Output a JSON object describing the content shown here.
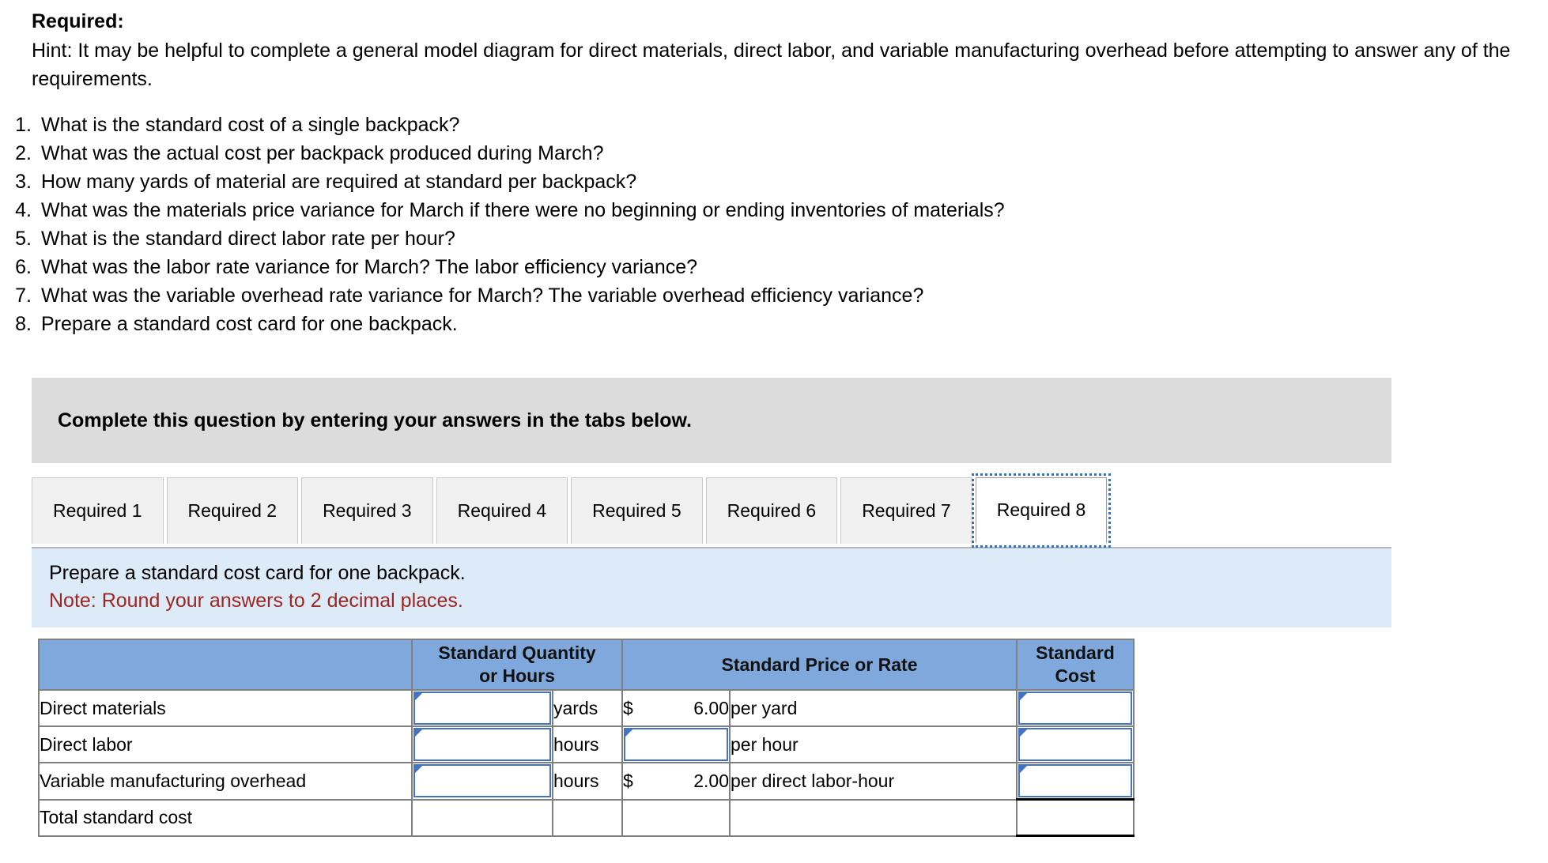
{
  "intro": {
    "title": "Required:",
    "hint": "Hint:  It may be helpful to complete a general model diagram for direct materials, direct labor, and variable manufacturing overhead before attempting to answer any of the requirements."
  },
  "requirements": [
    {
      "num": "1.",
      "text": "What is the standard cost of a single backpack?"
    },
    {
      "num": "2.",
      "text": "What was the actual cost per backpack produced during March?"
    },
    {
      "num": "3.",
      "text": "How many yards of material are required at standard per backpack?"
    },
    {
      "num": "4.",
      "text": "What was the materials price variance for March if there were no beginning or ending inventories of materials?"
    },
    {
      "num": "5.",
      "text": "What is the standard direct labor rate per hour?"
    },
    {
      "num": "6.",
      "text": "What was the labor rate variance for March? The labor efficiency variance?"
    },
    {
      "num": "7.",
      "text": "What was the variable overhead rate variance for March? The variable overhead efficiency variance?"
    },
    {
      "num": "8.",
      "text": "Prepare a standard cost card for one backpack."
    }
  ],
  "banner": {
    "text": "Complete this question by entering your answers in the tabs below."
  },
  "tabs": [
    {
      "label": "Required 1",
      "active": false
    },
    {
      "label": "Required 2",
      "active": false
    },
    {
      "label": "Required 3",
      "active": false
    },
    {
      "label": "Required 4",
      "active": false
    },
    {
      "label": "Required 5",
      "active": false
    },
    {
      "label": "Required 6",
      "active": false
    },
    {
      "label": "Required 7",
      "active": false
    },
    {
      "label": "Required 8",
      "active": true
    }
  ],
  "instruction": {
    "prompt": "Prepare a standard cost card for one backpack.",
    "note": "Note: Round your answers to 2 decimal places."
  },
  "cost_card": {
    "headers": {
      "blank": "",
      "quantity": "Standard Quantity or Hours",
      "quantity_line1": "Standard Quantity",
      "quantity_line2": "or Hours",
      "price": "Standard Price or Rate",
      "cost_line1": "Standard",
      "cost_line2": "Cost"
    },
    "rows": [
      {
        "label": "Direct materials",
        "qty_value": "",
        "unit": "yards",
        "price_symbol": "$",
        "price_value": "6.00",
        "price_is_input": false,
        "rate_text": "per yard",
        "cost_value": ""
      },
      {
        "label": "Direct labor",
        "qty_value": "",
        "unit": "hours",
        "price_symbol": "",
        "price_value": "",
        "price_is_input": true,
        "rate_text": "per hour",
        "cost_value": ""
      },
      {
        "label": "Variable manufacturing overhead",
        "qty_value": "",
        "unit": "hours",
        "price_symbol": "$",
        "price_value": "2.00",
        "price_is_input": false,
        "rate_text": "per direct labor-hour",
        "cost_value": ""
      }
    ],
    "total_row": {
      "label": "Total standard cost",
      "qty_value": "",
      "unit": "",
      "price_value": "",
      "rate_text": "",
      "cost_value": ""
    }
  },
  "colors": {
    "header_blue": "#7fa8dc",
    "banner_gray": "#dcdcdc",
    "instruction_blue": "#ddeaf7",
    "note_red": "#9c2621",
    "input_border_blue": "#4472c4",
    "table_border_gray": "#808080"
  }
}
